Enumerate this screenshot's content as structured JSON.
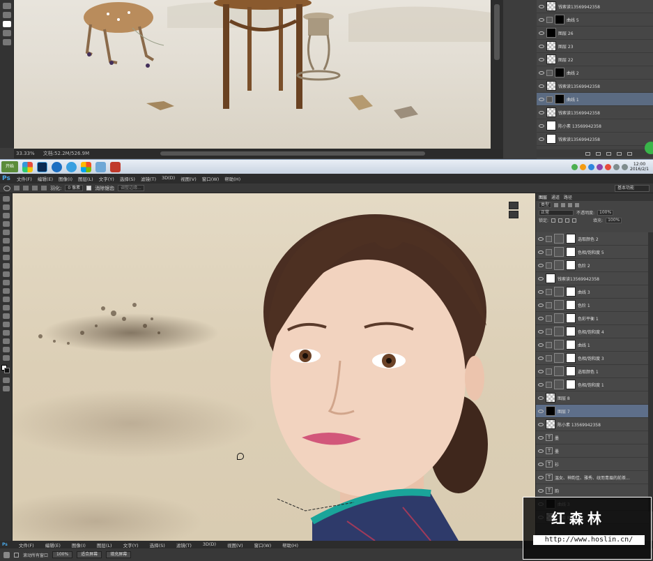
{
  "top_window": {
    "status_zoom": "33.33%",
    "status_doc": "文档:52.2M/526.9M",
    "layers": [
      {
        "name": "钱索读13569942358",
        "thumb": "checker"
      },
      {
        "name": "曲线 5",
        "thumb": "mask-black",
        "adjust": true
      },
      {
        "name": "图层 26",
        "thumb": "mask-black"
      },
      {
        "name": "图层 23",
        "thumb": "checker"
      },
      {
        "name": "图层 22",
        "thumb": "checker"
      },
      {
        "name": "曲线 2",
        "thumb": "mask-black",
        "adjust": true
      },
      {
        "name": "钱索读13569942358",
        "thumb": "checker"
      },
      {
        "name": "曲线 1",
        "thumb": "mask-black",
        "adjust": true,
        "selected": true
      },
      {
        "name": "钱索读13569942358",
        "thumb": "checker"
      },
      {
        "name": "陈小素 13569942358",
        "thumb": "white"
      },
      {
        "name": "钱索读13569942358",
        "thumb": "white"
      }
    ]
  },
  "taskbar": {
    "start": "开始",
    "clock_time": "12:00",
    "clock_date": "2016/2/1"
  },
  "menubar": {
    "logo": "Ps",
    "items": [
      "文件(F)",
      "编辑(E)",
      "图像(I)",
      "图层(L)",
      "文字(Y)",
      "选择(S)",
      "滤镜(T)",
      "3D(D)",
      "视图(V)",
      "窗口(W)",
      "帮助(H)"
    ]
  },
  "options_bar": {
    "feather_label": "羽化:",
    "feather_value": "0 像素",
    "antialias_label": "消除锯齿",
    "refine_edge": "调整边缘...",
    "workspace": "基本功能"
  },
  "layers_panel": {
    "tabs": [
      "图层",
      "通道",
      "路径"
    ],
    "filter_kind": "类型",
    "blend_mode": "正常",
    "opacity_label": "不透明度:",
    "opacity_value": "100%",
    "lock_label": "锁定:",
    "fill_label": "填充:",
    "fill_value": "100%",
    "layers": [
      {
        "name": "选取颜色 2",
        "thumb": "adjust"
      },
      {
        "name": "色相/饱和度 5",
        "thumb": "adjust"
      },
      {
        "name": "色阶 2",
        "thumb": "adjust"
      },
      {
        "name": "钱索读13569942358",
        "thumb": "white"
      },
      {
        "name": "曲线 3",
        "thumb": "adjust"
      },
      {
        "name": "色阶 1",
        "thumb": "adjust"
      },
      {
        "name": "色彩平衡 1",
        "thumb": "adjust"
      },
      {
        "name": "色相/饱和度 4",
        "thumb": "adjust"
      },
      {
        "name": "曲线 1",
        "thumb": "adjust"
      },
      {
        "name": "色相/饱和度 3",
        "thumb": "adjust"
      },
      {
        "name": "选取颜色 1",
        "thumb": "adjust"
      },
      {
        "name": "色相/饱和度 1",
        "thumb": "adjust"
      },
      {
        "name": "图层 8",
        "thumb": "checker"
      },
      {
        "name": "图层 7",
        "thumb": "mask-black",
        "selected": true
      },
      {
        "name": "陈小素 13569942358",
        "thumb": "checker"
      },
      {
        "name": "墨",
        "thumb": "text"
      },
      {
        "name": "墨",
        "thumb": "text"
      },
      {
        "name": "衫",
        "thumb": "text"
      },
      {
        "name": "温女、神韵佳、雅秀、纹而青眉的前茶...",
        "thumb": "text"
      },
      {
        "name": "韵",
        "thumb": "text"
      },
      {
        "name": "曲线 3",
        "thumb": "mask-black"
      },
      {
        "name": "图层 8",
        "thumb": "checker"
      }
    ]
  },
  "status_bar": {
    "menu_items": [
      "文件(F)",
      "编辑(E)",
      "图像(I)",
      "图层(L)",
      "文字(Y)",
      "选择(S)",
      "滤镜(T)",
      "3D(D)",
      "视图(V)",
      "窗口(W)",
      "帮助(H)"
    ]
  },
  "bottom_options": {
    "scroll_all": "滚动所有窗口",
    "zoom": "100%",
    "fit_screen": "适合屏幕",
    "fill_screen": "填充屏幕"
  },
  "watermark": {
    "cn": "红森林",
    "url": "http://www.hoslin.cn/"
  },
  "colors": {
    "accent_selected": "#5e6f8a",
    "ps_blue": "#4aa8e8"
  }
}
